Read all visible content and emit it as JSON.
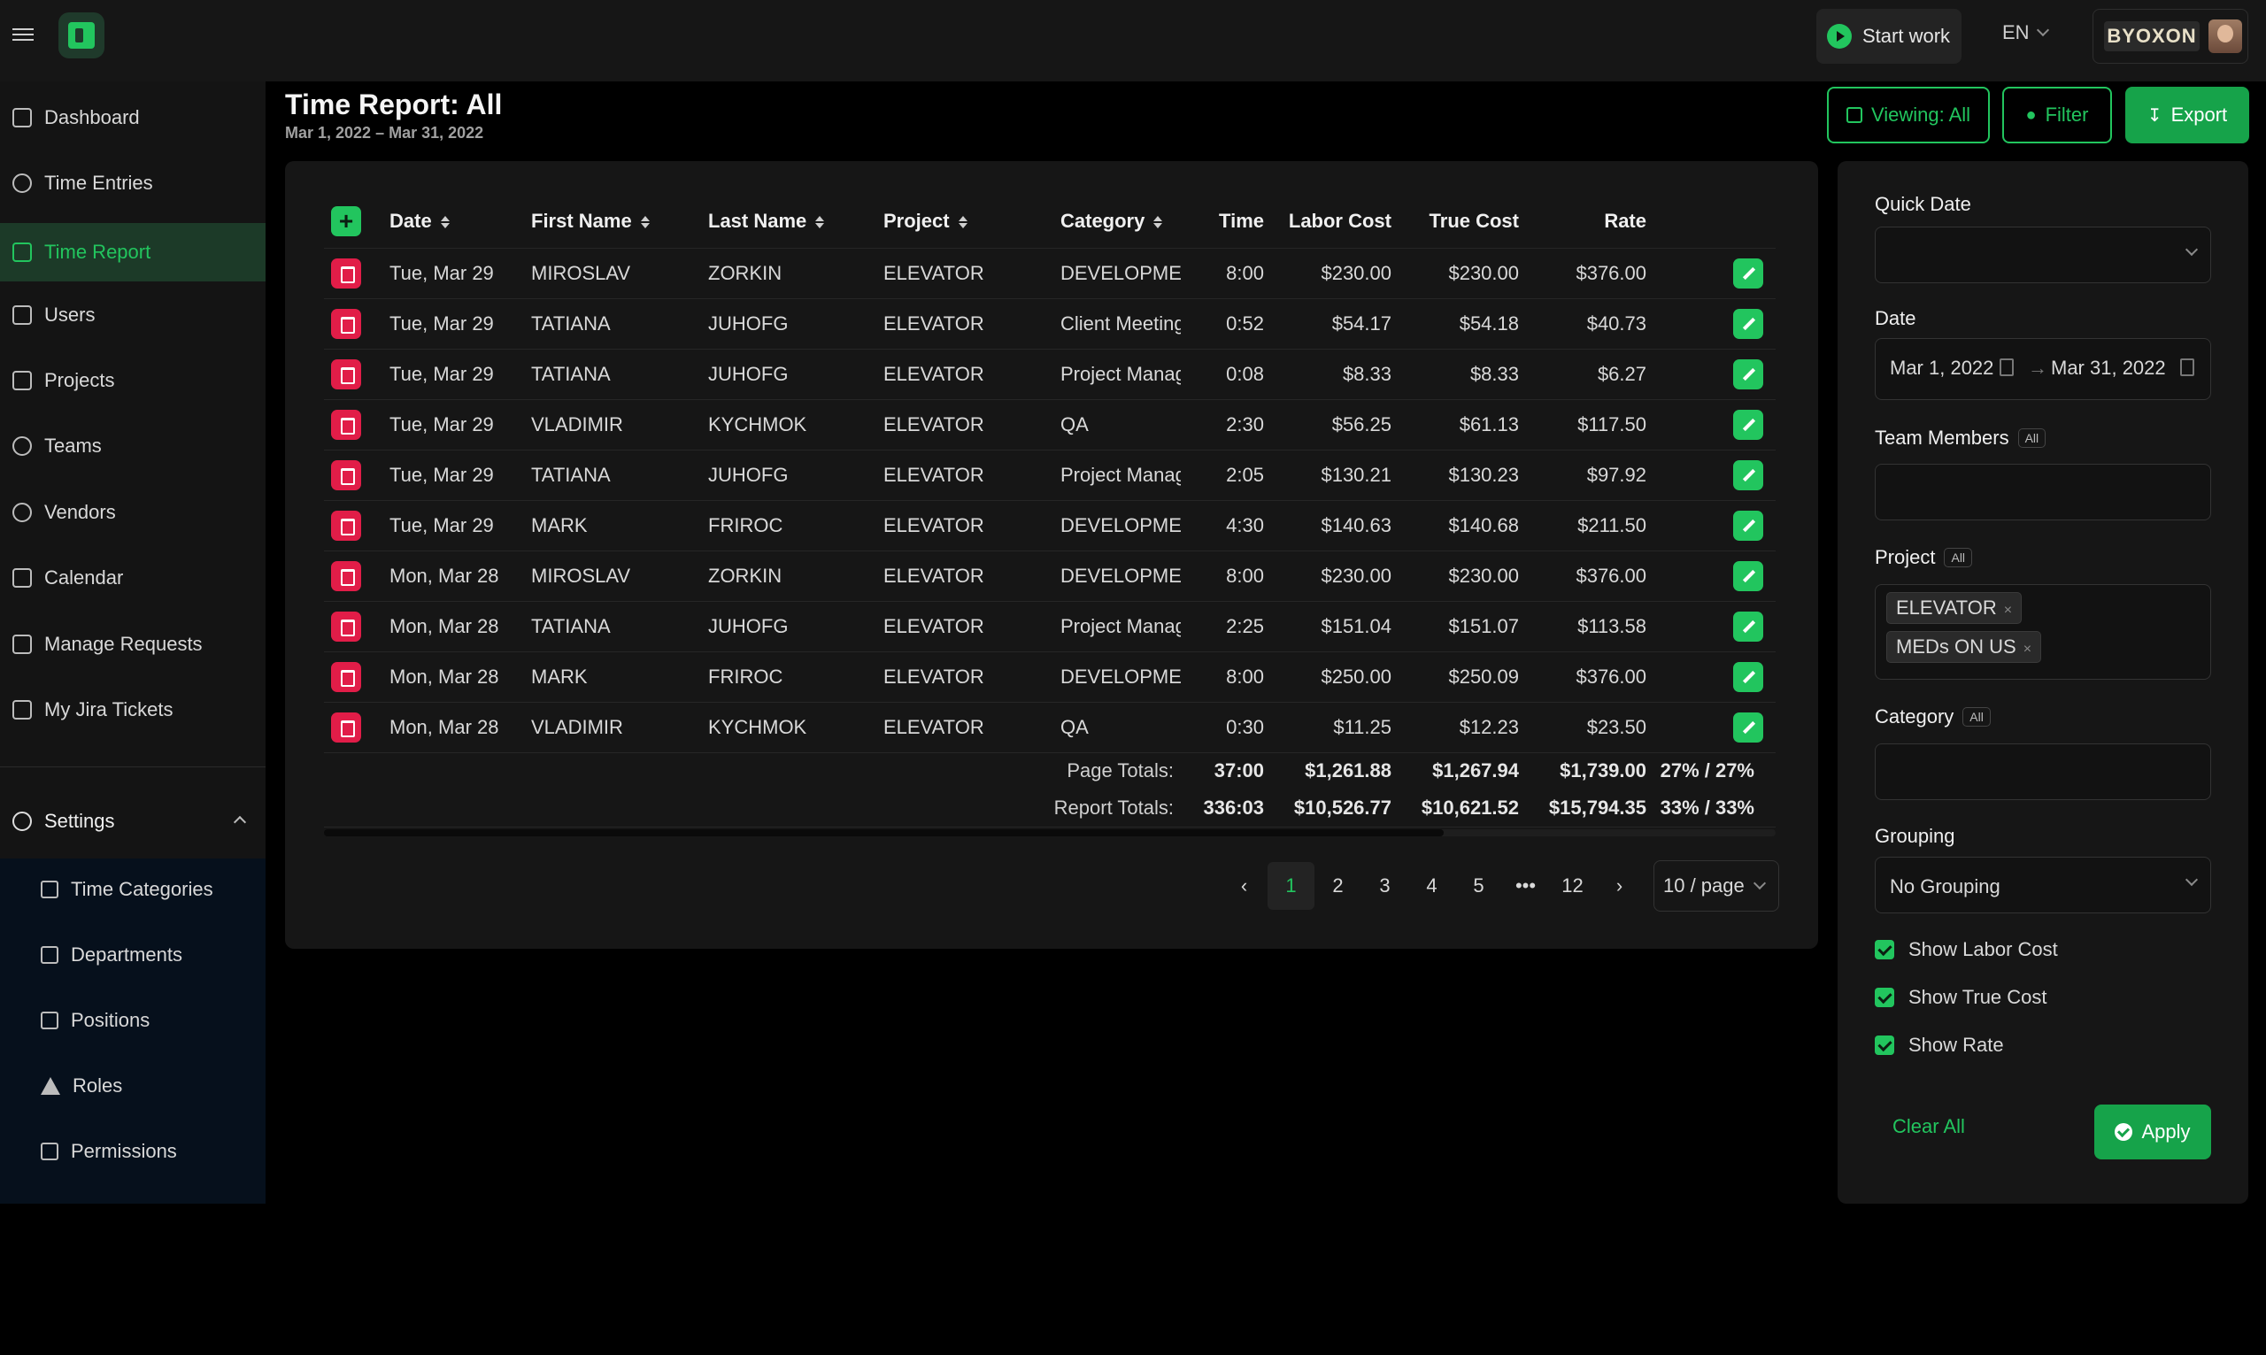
{
  "topbar": {
    "start_work": "Start work",
    "lang": "EN",
    "account_brand": "BYOXON"
  },
  "sidebar": {
    "items": [
      {
        "label": "Dashboard",
        "icon": "grid-icon"
      },
      {
        "label": "Time Entries",
        "icon": "clock-icon"
      },
      {
        "label": "Time Report",
        "icon": "report-icon",
        "active": true
      },
      {
        "label": "Users",
        "icon": "users-icon"
      },
      {
        "label": "Projects",
        "icon": "briefcase-icon"
      },
      {
        "label": "Teams",
        "icon": "team-icon"
      },
      {
        "label": "Vendors",
        "icon": "vendor-icon"
      },
      {
        "label": "Calendar",
        "icon": "calendar-icon"
      },
      {
        "label": "Manage Requests",
        "icon": "requests-icon"
      },
      {
        "label": "My Jira Tickets",
        "icon": "list-icon"
      }
    ],
    "settings_label": "Settings",
    "sub_items": [
      {
        "label": "Time Categories"
      },
      {
        "label": "Departments"
      },
      {
        "label": "Positions"
      },
      {
        "label": "Roles"
      },
      {
        "label": "Permissions"
      }
    ]
  },
  "header": {
    "title": "Time Report: All",
    "date_range": "Mar 1, 2022 – Mar 31, 2022",
    "viewing_btn": "Viewing: All",
    "filter_btn": "Filter",
    "export_btn": "Export"
  },
  "table": {
    "columns": [
      "Date",
      "First Name",
      "Last Name",
      "Project",
      "Category",
      "Time",
      "Labor Cost",
      "True Cost",
      "Rate"
    ],
    "rows": [
      [
        "Tue, Mar 29",
        "MIROSLAV",
        "ZORKIN",
        "ELEVATOR",
        "DEVELOPMENT",
        "8:00",
        "$230.00",
        "$230.00",
        "$376.00"
      ],
      [
        "Tue, Mar 29",
        "TATIANA",
        "JUHOFG",
        "ELEVATOR",
        "Client Meeting",
        "0:52",
        "$54.17",
        "$54.18",
        "$40.73"
      ],
      [
        "Tue, Mar 29",
        "TATIANA",
        "JUHOFG",
        "ELEVATOR",
        "Project Management",
        "0:08",
        "$8.33",
        "$8.33",
        "$6.27"
      ],
      [
        "Tue, Mar 29",
        "VLADIMIR",
        "KYCHMOK",
        "ELEVATOR",
        "QA",
        "2:30",
        "$56.25",
        "$61.13",
        "$117.50"
      ],
      [
        "Tue, Mar 29",
        "TATIANA",
        "JUHOFG",
        "ELEVATOR",
        "Project Management",
        "2:05",
        "$130.21",
        "$130.23",
        "$97.92"
      ],
      [
        "Tue, Mar 29",
        "MARK",
        "FRIROC",
        "ELEVATOR",
        "DEVELOPMENT",
        "4:30",
        "$140.63",
        "$140.68",
        "$211.50"
      ],
      [
        "Mon, Mar 28",
        "MIROSLAV",
        "ZORKIN",
        "ELEVATOR",
        "DEVELOPMENT",
        "8:00",
        "$230.00",
        "$230.00",
        "$376.00"
      ],
      [
        "Mon, Mar 28",
        "TATIANA",
        "JUHOFG",
        "ELEVATOR",
        "Project Management",
        "2:25",
        "$151.04",
        "$151.07",
        "$113.58"
      ],
      [
        "Mon, Mar 28",
        "MARK",
        "FRIROC",
        "ELEVATOR",
        "DEVELOPMENT",
        "8:00",
        "$250.00",
        "$250.09",
        "$376.00"
      ],
      [
        "Mon, Mar 28",
        "VLADIMIR",
        "KYCHMOK",
        "ELEVATOR",
        "QA",
        "0:30",
        "$11.25",
        "$12.23",
        "$23.50"
      ]
    ],
    "page_totals": {
      "label": "Page Totals:",
      "time": "37:00",
      "labor": "$1,261.88",
      "true": "$1,267.94",
      "rate": "$1,739.00",
      "pct": "27% / 27%"
    },
    "report_totals": {
      "label": "Report Totals:",
      "time": "336:03",
      "labor": "$10,526.77",
      "true": "$10,621.52",
      "rate": "$15,794.35",
      "pct": "33% / 33%"
    }
  },
  "pagination": {
    "pages": [
      "1",
      "2",
      "3",
      "4",
      "5",
      "•••",
      "12"
    ],
    "active": "1",
    "per_page": "10 / page"
  },
  "filter_panel": {
    "quick_date_label": "Quick Date",
    "quick_date_value": "",
    "date_label": "Date",
    "date_from": "Mar 1, 2022",
    "date_to": "Mar 31, 2022",
    "team_members_label": "Team Members",
    "all_tag": "All",
    "project_label": "Project",
    "project_tags": [
      "ELEVATOR",
      "MEDs ON US"
    ],
    "category_label": "Category",
    "grouping_label": "Grouping",
    "grouping_value": "No Grouping",
    "show_labor_cost": "Show Labor Cost",
    "show_true_cost": "Show True Cost",
    "show_rate": "Show Rate",
    "clear_all": "Clear All",
    "apply": "Apply"
  },
  "colors": {
    "accent": "#22c55e",
    "danger": "#e11d48",
    "background": "#000000"
  }
}
